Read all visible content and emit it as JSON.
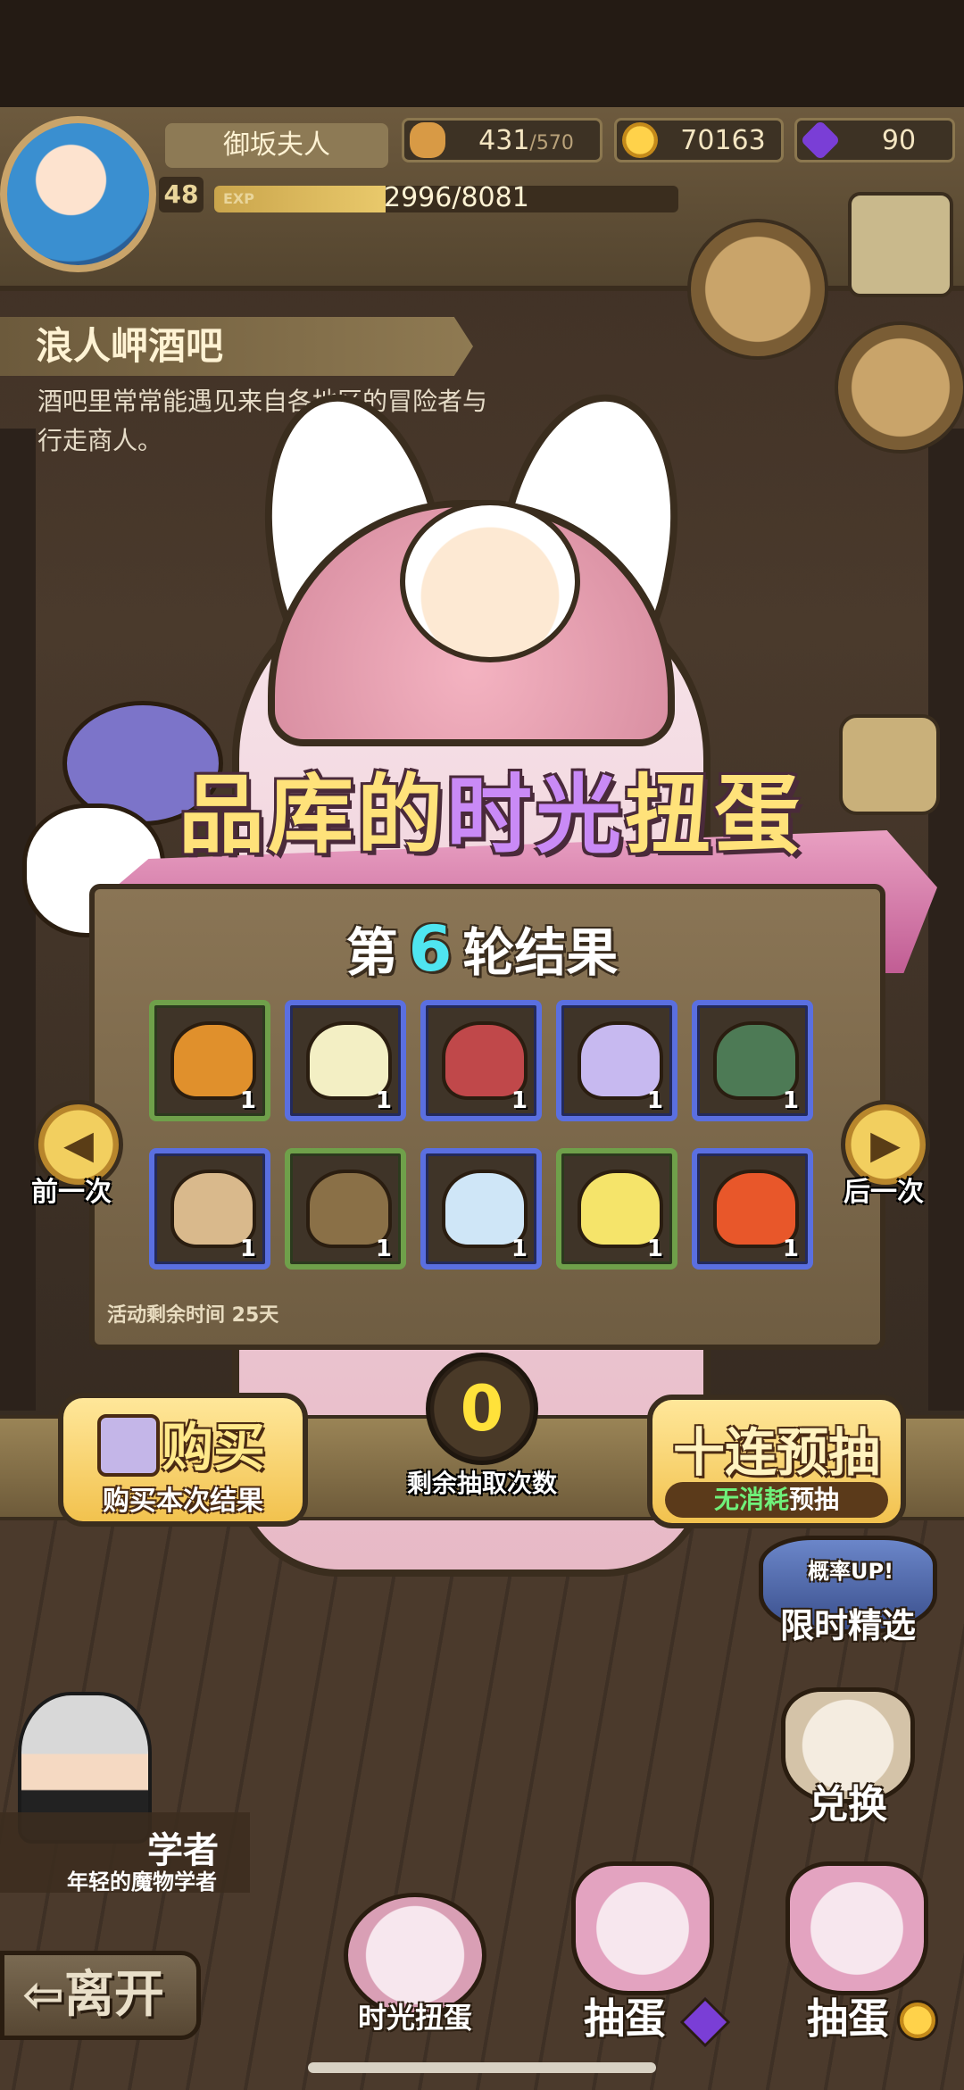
{
  "player": {
    "name": "御坂夫人",
    "level": "48",
    "exp_label": "EXP",
    "exp_text": "2996/8081",
    "exp_fraction": 0.37
  },
  "resources": {
    "stamina_current": "431",
    "stamina_max": "/570",
    "gold": "70163",
    "gems": "90"
  },
  "location": {
    "name": "浪人岬酒吧",
    "description": "酒吧里常常能遇见来自各地区的冒险者与行走商人。"
  },
  "gacha": {
    "title_part1": "品库的",
    "title_part2": "时光",
    "title_part3": "扭蛋",
    "round_prefix": "第",
    "round_number": "6",
    "round_suffix": "轮结果",
    "time_left": "活动剩余时间  25天",
    "prev_label": "前一次",
    "next_label": "后一次",
    "items": [
      {
        "name": "orange-helmet-icon",
        "rarity": "green",
        "qty": "1",
        "color": "#e0902c"
      },
      {
        "name": "lotus-crown-icon",
        "rarity": "blue",
        "qty": "1",
        "color": "#f3efc4"
      },
      {
        "name": "cat-ear-hood-icon",
        "rarity": "blue",
        "qty": "1",
        "color": "#c0484a"
      },
      {
        "name": "jelly-cap-icon",
        "rarity": "blue",
        "qty": "1",
        "color": "#c7b9f0"
      },
      {
        "name": "dino-mask-icon",
        "rarity": "blue",
        "qty": "1",
        "color": "#4d7a55"
      },
      {
        "name": "fur-hat-icon",
        "rarity": "blue",
        "qty": "1",
        "color": "#d9b98c"
      },
      {
        "name": "wicker-helmet-icon",
        "rarity": "green",
        "qty": "1",
        "color": "#8a7047"
      },
      {
        "name": "cloud-wing-icon",
        "rarity": "blue",
        "qty": "1",
        "color": "#cfe6f7"
      },
      {
        "name": "bulb-helmet-icon",
        "rarity": "green",
        "qty": "1",
        "color": "#f5e46a"
      },
      {
        "name": "fire-swirl-icon",
        "rarity": "blue",
        "qty": "1",
        "color": "#e8572a"
      }
    ]
  },
  "actions": {
    "buy_title": "购买",
    "buy_sub": "购买本次结果",
    "draw_count": "0",
    "draw_count_label": "剩余抽取次数",
    "ten_title": "十连预抽",
    "ten_sub_green": "无消耗",
    "ten_sub_white": "预抽"
  },
  "features": {
    "limited_badge": "概率UP!",
    "limited_label": "限时精选",
    "exchange_label": "兑换",
    "time_gacha_label": "时光扭蛋",
    "egg1_label": "抽蛋",
    "egg2_label": "抽蛋"
  },
  "npc": {
    "name": "学者",
    "description": "年轻的魔物学者"
  },
  "leave_label": "离开"
}
